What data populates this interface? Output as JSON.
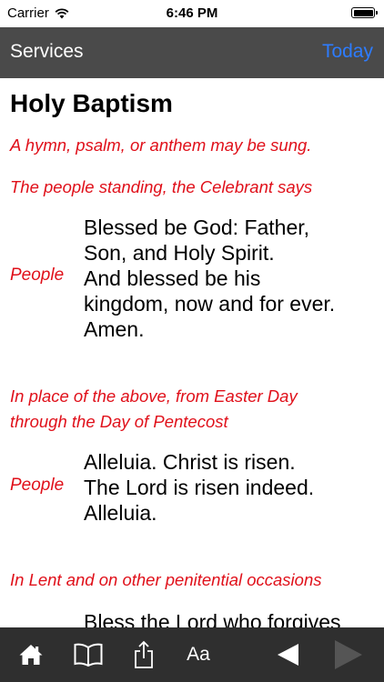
{
  "status": {
    "carrier": "Carrier",
    "time": "6:46 PM"
  },
  "nav": {
    "back_label": "Services",
    "today_label": "Today"
  },
  "page": {
    "title": "Holy Baptism",
    "rubric1": "A hymn, psalm, or anthem may be sung.",
    "rubric2": "The people standing, the Celebrant says",
    "block1": {
      "speaker": "People",
      "lines": [
        "Blessed be God: Father,",
        "Son, and Holy Spirit.",
        "And blessed be his",
        "kingdom, now and for ever.",
        "Amen."
      ]
    },
    "rubric3": [
      "In place of the above, from Easter Day",
      "through the Day of Pentecost"
    ],
    "block2": {
      "speaker": "People",
      "lines": [
        "Alleluia. Christ is risen.",
        "The Lord is risen indeed.",
        "Alleluia."
      ]
    },
    "rubric4": "In Lent and on other penitential occasions",
    "block3": {
      "lines": [
        "Bless the Lord who forgives"
      ]
    }
  },
  "toolbar": {
    "home_icon": "home-icon",
    "book_icon": "book-icon",
    "share_icon": "share-icon",
    "font_label": "Aa",
    "prev_icon": "triangle-left-icon",
    "next_icon": "triangle-right-icon"
  },
  "colors": {
    "rubric": "#e0101a",
    "nav_bg": "#4a4a4a",
    "toolbar_bg": "#2f2f2f",
    "link": "#2d7cff"
  }
}
